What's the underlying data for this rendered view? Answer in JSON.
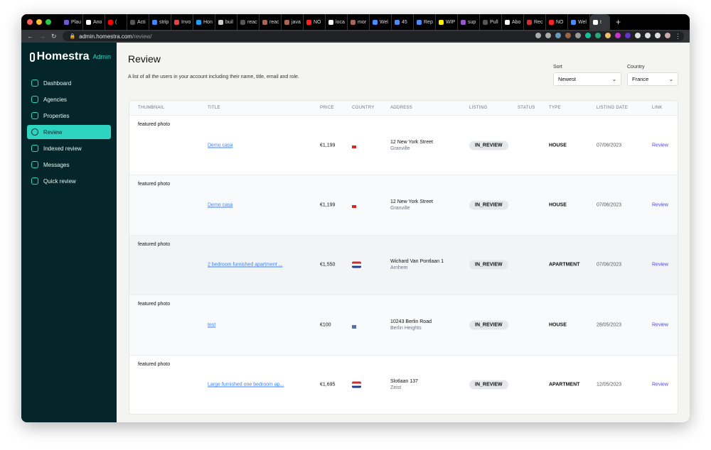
{
  "browser": {
    "tabs": [
      "Plau",
      "Ano",
      "(",
      "Acti",
      "strip",
      "Invo",
      "Hon",
      "buil",
      "reac",
      "reac",
      "java",
      "NO",
      "loca",
      "mor",
      "Wel",
      "45",
      "Rep",
      "WIP",
      "sup",
      "Pull",
      "Abo",
      "Rec",
      "NO",
      "Wel",
      "t"
    ],
    "url_host": "admin.homestra.com",
    "url_path": "/review/"
  },
  "sidebar": {
    "brand": "Homestra",
    "brand_badge": "Admin",
    "items": [
      {
        "label": "Dashboard"
      },
      {
        "label": "Agencies"
      },
      {
        "label": "Properties"
      },
      {
        "label": "Review",
        "active": true
      },
      {
        "label": "Indexed review"
      },
      {
        "label": "Messages"
      },
      {
        "label": "Quick review"
      }
    ]
  },
  "page": {
    "title": "Review",
    "subtitle": "A list of all the users in your account including their name, title, email and role."
  },
  "filters": {
    "sort_label": "Sort",
    "sort_value": "Newest",
    "country_label": "Country",
    "country_value": "France"
  },
  "table": {
    "columns": [
      "THUMBNAIL",
      "TITLE",
      "PRICE",
      "COUNTRY",
      "ADDRESS",
      "LISTING",
      "STATUS",
      "TYPE",
      "LISTING DATE",
      "LINK"
    ],
    "rows": [
      {
        "thumb": "featured photo",
        "title": "Demo casa",
        "price": "€1,199",
        "flag": "au",
        "street": "12 New York Street",
        "city": "Granville",
        "listing": "IN_REVIEW",
        "status": "",
        "type": "HOUSE",
        "date": "07/06/2023",
        "link": "Review"
      },
      {
        "thumb": "featured photo",
        "title": "Demo casa",
        "price": "€1,199",
        "flag": "au",
        "street": "12 New York Street",
        "city": "Granville",
        "listing": "IN_REVIEW",
        "status": "",
        "type": "HOUSE",
        "date": "07/06/2023",
        "link": "Review"
      },
      {
        "thumb": "featured photo",
        "title": "2 bedroom furnished apartment ...",
        "price": "€1,550",
        "flag": "nl",
        "street": "Wichard Van Pontlaan 1",
        "city": "Arnhem",
        "listing": "IN_REVIEW",
        "status": "",
        "type": "APARTMENT",
        "date": "07/06/2023",
        "link": "Review"
      },
      {
        "thumb": "featured photo",
        "title": "test",
        "price": "€100",
        "flag": "us",
        "street": "10243 Berlin Road",
        "city": "Berlin Heights",
        "listing": "IN_REVIEW",
        "status": "",
        "type": "HOUSE",
        "date": "28/05/2023",
        "link": "Review"
      },
      {
        "thumb": "featured photo",
        "title": "Large furnished one bedroom ap...",
        "price": "€1,695",
        "flag": "nl",
        "street": "Slotlaan 137",
        "city": "Zeist",
        "listing": "IN_REVIEW",
        "status": "",
        "type": "APARTMENT",
        "date": "12/05/2023",
        "link": "Review"
      }
    ]
  },
  "colors": {
    "sidebar": "#04262b",
    "accent": "#2dd4bf",
    "link": "#3b82f6",
    "review_link": "#4f46e5"
  }
}
